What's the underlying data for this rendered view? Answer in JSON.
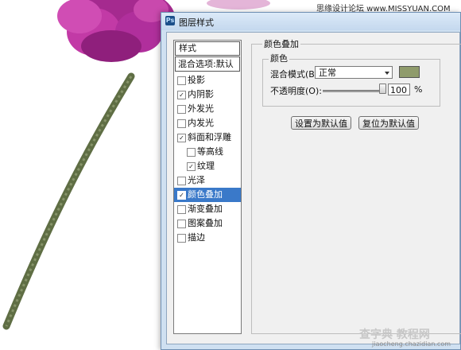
{
  "watermark": {
    "top": "思缘设计论坛 www.MISSYUAN.COM",
    "bottom": "查字典 教程网",
    "url": "jiaocheng.chazidian.com"
  },
  "dialog": {
    "title": "图层样式",
    "list_header": "样式",
    "blend_options": "混合选项:默认",
    "items": [
      {
        "label": "投影",
        "checked": "",
        "sub": false
      },
      {
        "label": "内阴影",
        "checked": "✓",
        "sub": false
      },
      {
        "label": "外发光",
        "checked": "",
        "sub": false
      },
      {
        "label": "内发光",
        "checked": "",
        "sub": false
      },
      {
        "label": "斜面和浮雕",
        "checked": "✓",
        "sub": false
      },
      {
        "label": "等高线",
        "checked": "",
        "sub": true
      },
      {
        "label": "纹理",
        "checked": "✓",
        "sub": true
      },
      {
        "label": "光泽",
        "checked": "",
        "sub": false
      },
      {
        "label": "颜色叠加",
        "checked": "✓",
        "sub": false,
        "selected": true
      },
      {
        "label": "渐变叠加",
        "checked": "",
        "sub": false
      },
      {
        "label": "图案叠加",
        "checked": "",
        "sub": false
      },
      {
        "label": "描边",
        "checked": "",
        "sub": false
      }
    ],
    "panel": {
      "title": "颜色叠加",
      "group_title": "颜色",
      "blend_mode_label": "混合模式(B):",
      "blend_mode_value": "正常",
      "overlay_color": "#8f9b6b",
      "opacity_label": "不透明度(O):",
      "opacity_value": "100",
      "opacity_unit": "%",
      "opacity_level": 1.0,
      "set_default": "设置为默认值",
      "reset_default": "复位为默认值"
    }
  },
  "colors": {
    "selection": "#3a79c9",
    "petal": "#b0309a",
    "stem": "#5f6e44"
  }
}
